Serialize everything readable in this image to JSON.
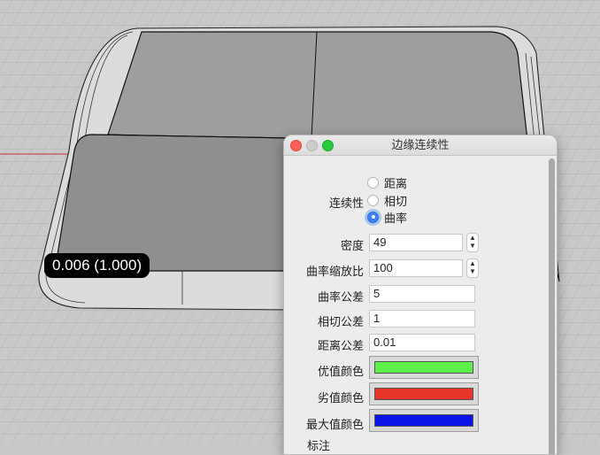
{
  "viewport": {
    "readout": "0.006 (1.000)",
    "colors": {
      "background": "#c9c9c9",
      "surface": "#9b9b9b",
      "grid": "#b5b5b5",
      "axis_red": "#d03030"
    }
  },
  "panel": {
    "title": "边缘连续性",
    "continuity_label": "连续性",
    "continuity_options": [
      "距离",
      "相切",
      "曲率"
    ],
    "continuity_selected": "曲率",
    "density_label": "密度",
    "density_value": "49",
    "curvature_scale_label": "曲率缩放比",
    "curvature_scale_value": "100",
    "curvature_tol_label": "曲率公差",
    "curvature_tol_value": "5",
    "tangent_tol_label": "相切公差",
    "tangent_tol_value": "1",
    "distance_tol_label": "距离公差",
    "distance_tol_value": "0.01",
    "good_color_label": "优值颜色",
    "good_color": "#5ef04a",
    "bad_color_label": "劣值颜色",
    "bad_color": "#e8352b",
    "max_color_label": "最大值颜色",
    "max_color": "#0a14e6",
    "annotation_label": "标注"
  }
}
